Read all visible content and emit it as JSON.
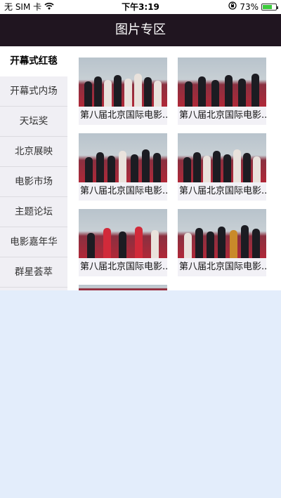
{
  "status_bar": {
    "carrier": "无 SIM 卡",
    "wifi_icon": "wifi-icon",
    "time": "下午3:19",
    "lock_icon": "orientation-lock-icon",
    "battery_percent": "73%",
    "battery_level": 0.73,
    "battery_color": "#3ccb3c"
  },
  "nav": {
    "title": "图片专区",
    "background": "#201520"
  },
  "sidebar": {
    "items": [
      {
        "label": "开幕式红毯",
        "active": true
      },
      {
        "label": "开幕式内场",
        "active": false
      },
      {
        "label": "天坛奖",
        "active": false
      },
      {
        "label": "北京展映",
        "active": false
      },
      {
        "label": "电影市场",
        "active": false
      },
      {
        "label": "主题论坛",
        "active": false
      },
      {
        "label": "电影嘉年华",
        "active": false
      },
      {
        "label": "群星荟萃",
        "active": false
      }
    ]
  },
  "gallery": {
    "cards": [
      {
        "caption": "第八届北京国际电影..."
      },
      {
        "caption": "第八届北京国际电影..."
      },
      {
        "caption": "第八届北京国际电影..."
      },
      {
        "caption": "第八届北京国际电影..."
      },
      {
        "caption": "第八届北京国际电影..."
      },
      {
        "caption": "第八届北京国际电影..."
      }
    ]
  }
}
